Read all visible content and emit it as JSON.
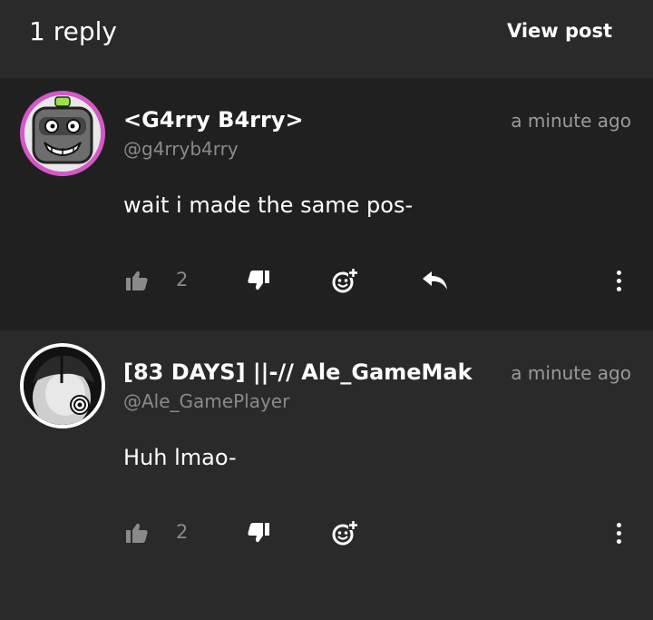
{
  "header": {
    "title": "1 reply",
    "view_post_label": "View post"
  },
  "comments": [
    {
      "username": "<G4rry B4rry>",
      "handle": "@g4rryb4rry",
      "timestamp": "a minute ago",
      "text": "wait i made the same pos-",
      "like_count": "2",
      "avatar_border_color": "#d558c8",
      "has_reply_button": true
    },
    {
      "username": "[83 DAYS] ||-// Ale_GameMak",
      "handle": "@Ale_GamePlayer",
      "timestamp": "a minute ago",
      "text": "Huh lmao-",
      "like_count": "2",
      "avatar_border_color": "#ffffff",
      "has_reply_button": false
    }
  ],
  "icons": {
    "like": "thumbs-up-icon",
    "dislike": "thumbs-down-icon",
    "react": "add-reaction-icon",
    "reply": "reply-arrow-icon",
    "more": "more-vertical-icon"
  }
}
